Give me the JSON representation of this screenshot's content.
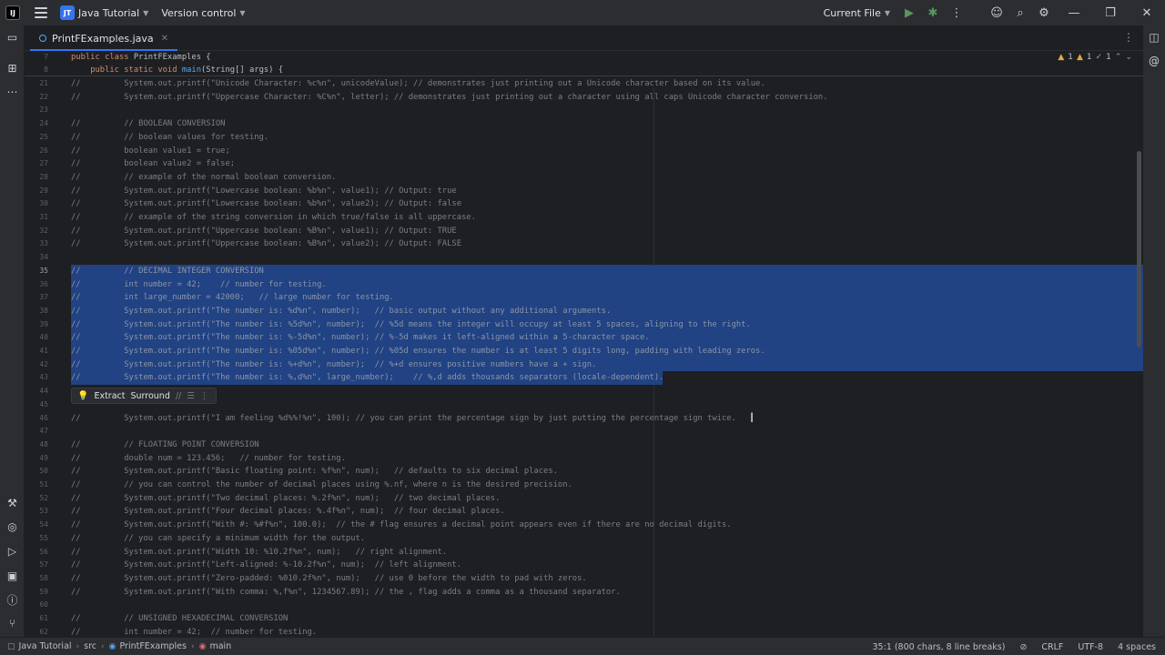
{
  "titlebar": {
    "project_badge": "JT",
    "project_name": "Java Tutorial",
    "vcs_label": "Version control",
    "run_config": "Current File",
    "icons": [
      "app-logo-icon",
      "main-menu-icon",
      "run-icon",
      "debug-icon",
      "more-icon",
      "add-user-icon",
      "search-icon",
      "settings-icon",
      "minimize-icon",
      "restore-icon",
      "close-icon"
    ]
  },
  "tabs": [
    {
      "label": "PrintFExamples.java",
      "active": true
    }
  ],
  "inspections": {
    "warnings": "1",
    "weak_warnings": "1",
    "ok": "1"
  },
  "sticky": {
    "lines": [
      {
        "num": "7",
        "text": "public class PrintFExamples {"
      },
      {
        "num": "8",
        "text": "    public static void main(String[] args) {"
      }
    ]
  },
  "editor": {
    "lines": [
      {
        "num": "21",
        "text": "//         System.out.printf(\"Unicode Character: %c%n\", unicodeValue); // demonstrates just printing out a Unicode character based on its value."
      },
      {
        "num": "22",
        "text": "//         System.out.printf(\"Uppercase Character: %C%n\", letter); // demonstrates just printing out a character using all caps Unicode character conversion."
      },
      {
        "num": "23",
        "text": ""
      },
      {
        "num": "24",
        "text": "//         // BOOLEAN CONVERSION"
      },
      {
        "num": "25",
        "text": "//         // boolean values for testing."
      },
      {
        "num": "26",
        "text": "//         boolean value1 = true;"
      },
      {
        "num": "27",
        "text": "//         boolean value2 = false;"
      },
      {
        "num": "28",
        "text": "//         // example of the normal boolean conversion."
      },
      {
        "num": "29",
        "text": "//         System.out.printf(\"Lowercase boolean: %b%n\", value1); // Output: true"
      },
      {
        "num": "30",
        "text": "//         System.out.printf(\"Lowercase boolean: %b%n\", value2); // Output: false"
      },
      {
        "num": "31",
        "text": "//         // example of the string conversion in which true/false is all uppercase."
      },
      {
        "num": "32",
        "text": "//         System.out.printf(\"Uppercase boolean: %B%n\", value1); // Output: TRUE"
      },
      {
        "num": "33",
        "text": "//         System.out.printf(\"Uppercase boolean: %B%n\", value2); // Output: FALSE"
      },
      {
        "num": "34",
        "text": ""
      },
      {
        "num": "35",
        "text": "//         // DECIMAL INTEGER CONVERSION",
        "selected": true,
        "current": true
      },
      {
        "num": "36",
        "text": "//         int number = 42;    // number for testing.",
        "selected": true
      },
      {
        "num": "37",
        "text": "//         int large_number = 42000;   // large number for testing.",
        "selected": true
      },
      {
        "num": "38",
        "text": "//         System.out.printf(\"The number is: %d%n\", number);   // basic output without any additional arguments.",
        "selected": true
      },
      {
        "num": "39",
        "text": "//         System.out.printf(\"The number is: %5d%n\", number);  // %5d means the integer will occupy at least 5 spaces, aligning to the right.",
        "selected": true
      },
      {
        "num": "40",
        "text": "//         System.out.printf(\"The number is: %-5d%n\", number); // %-5d makes it left-aligned within a 5-character space.",
        "selected": true
      },
      {
        "num": "41",
        "text": "//         System.out.printf(\"The number is: %05d%n\", number); // %05d ensures the number is at least 5 digits long, padding with leading zeros.",
        "selected": true
      },
      {
        "num": "42",
        "text": "//         System.out.printf(\"The number is: %+d%n\", number);  // %+d ensures positive numbers have a + sign.",
        "selected": true
      },
      {
        "num": "43",
        "text": "//         System.out.printf(\"The number is: %,d%n\", large_number);    // %,d adds thousands separators (locale-dependent).",
        "selected": true,
        "partial": true
      },
      {
        "num": "44",
        "text": ""
      },
      {
        "num": "45",
        "text": ""
      },
      {
        "num": "46",
        "text": "//         System.out.printf(\"I am feeling %d%%!%n\", 100); // you can print the percentage sign by just putting the percentage sign twice."
      },
      {
        "num": "47",
        "text": ""
      },
      {
        "num": "48",
        "text": "//         // FLOATING POINT CONVERSION"
      },
      {
        "num": "49",
        "text": "//         double num = 123.456;   // number for testing."
      },
      {
        "num": "50",
        "text": "//         System.out.printf(\"Basic floating point: %f%n\", num);   // defaults to six decimal places."
      },
      {
        "num": "51",
        "text": "//         // you can control the number of decimal places using %.nf, where n is the desired precision."
      },
      {
        "num": "52",
        "text": "//         System.out.printf(\"Two decimal places: %.2f%n\", num);   // two decimal places."
      },
      {
        "num": "53",
        "text": "//         System.out.printf(\"Four decimal places: %.4f%n\", num);  // four decimal places."
      },
      {
        "num": "54",
        "text": "//         System.out.printf(\"With #: %#f%n\", 100.0);  // the # flag ensures a decimal point appears even if there are no decimal digits."
      },
      {
        "num": "55",
        "text": "//         // you can specify a minimum width for the output."
      },
      {
        "num": "56",
        "text": "//         System.out.printf(\"Width 10: %10.2f%n\", num);   // right alignment."
      },
      {
        "num": "57",
        "text": "//         System.out.printf(\"Left-aligned: %-10.2f%n\", num);  // left alignment."
      },
      {
        "num": "58",
        "text": "//         System.out.printf(\"Zero-padded: %010.2f%n\", num);   // use 0 before the width to pad with zeros."
      },
      {
        "num": "59",
        "text": "//         System.out.printf(\"With comma: %,f%n\", 1234567.89); // the , flag adds a comma as a thousand separator."
      },
      {
        "num": "60",
        "text": ""
      },
      {
        "num": "61",
        "text": "//         // UNSIGNED HEXADECIMAL CONVERSION"
      },
      {
        "num": "62",
        "text": "//         int number = 42;  // number for testing."
      }
    ]
  },
  "popup": {
    "extract": "Extract",
    "surround": "Surround",
    "comment": "//",
    "format": "☰",
    "more": "⋮"
  },
  "statusbar": {
    "crumbs": [
      "Java Tutorial",
      "src",
      "PrintFExamples",
      "main"
    ],
    "position": "35:1 (800 chars, 8 line breaks)",
    "line_sep": "CRLF",
    "encoding": "UTF-8",
    "indent": "4 spaces"
  },
  "colors": {
    "accent": "#3574f0",
    "selection": "#214283",
    "background": "#1e1f22",
    "panel": "#2b2d30"
  }
}
